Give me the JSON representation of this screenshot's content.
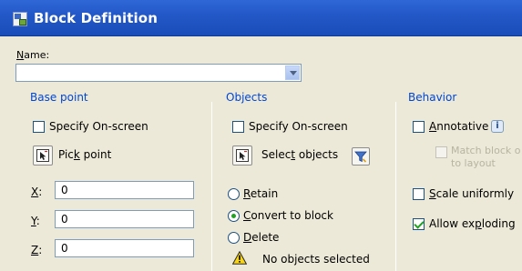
{
  "window": {
    "title": "Block Definition"
  },
  "name": {
    "label_prefix": "N",
    "label_rest": "ame:",
    "value": ""
  },
  "base_point": {
    "group_label": "Base point",
    "specify_label": "Specify On-screen",
    "pick_prefix": "Pic",
    "pick_underline": "k",
    "pick_suffix": " point",
    "x_label": "X",
    "x_suffix": ":",
    "x_value": "0",
    "y_label": "Y",
    "y_suffix": ":",
    "y_value": "0",
    "z_label": "Z",
    "z_suffix": ":",
    "z_value": "0"
  },
  "objects": {
    "group_label": "Objects",
    "specify_label": "Specify On-screen",
    "select_prefix": "Selec",
    "select_underline": "t",
    "select_suffix": " objects",
    "retain_underline": "R",
    "retain_rest": "etain",
    "convert_underline": "C",
    "convert_rest": "onvert to block",
    "delete_underline": "D",
    "delete_rest": "elete",
    "status": "No objects selected"
  },
  "behavior": {
    "group_label": "Behavior",
    "annotative_underline": "A",
    "annotative_rest": "nnotative",
    "info_glyph": "i",
    "match_line1": "Match block o",
    "match_line2": "to layout",
    "scale_underline": "S",
    "scale_rest": "cale uniformly",
    "explode_prefix": "Allow ex",
    "explode_underline": "p",
    "explode_suffix": "loding"
  },
  "state": {
    "base_specify_checked": false,
    "objects_specify_checked": false,
    "object_mode": "convert",
    "annotative_checked": false,
    "match_checked": false,
    "scale_checked": false,
    "explode_checked": true
  },
  "colors": {
    "title_bar": "#2358c8",
    "group_label": "#0046d5",
    "check": "#21a121"
  }
}
